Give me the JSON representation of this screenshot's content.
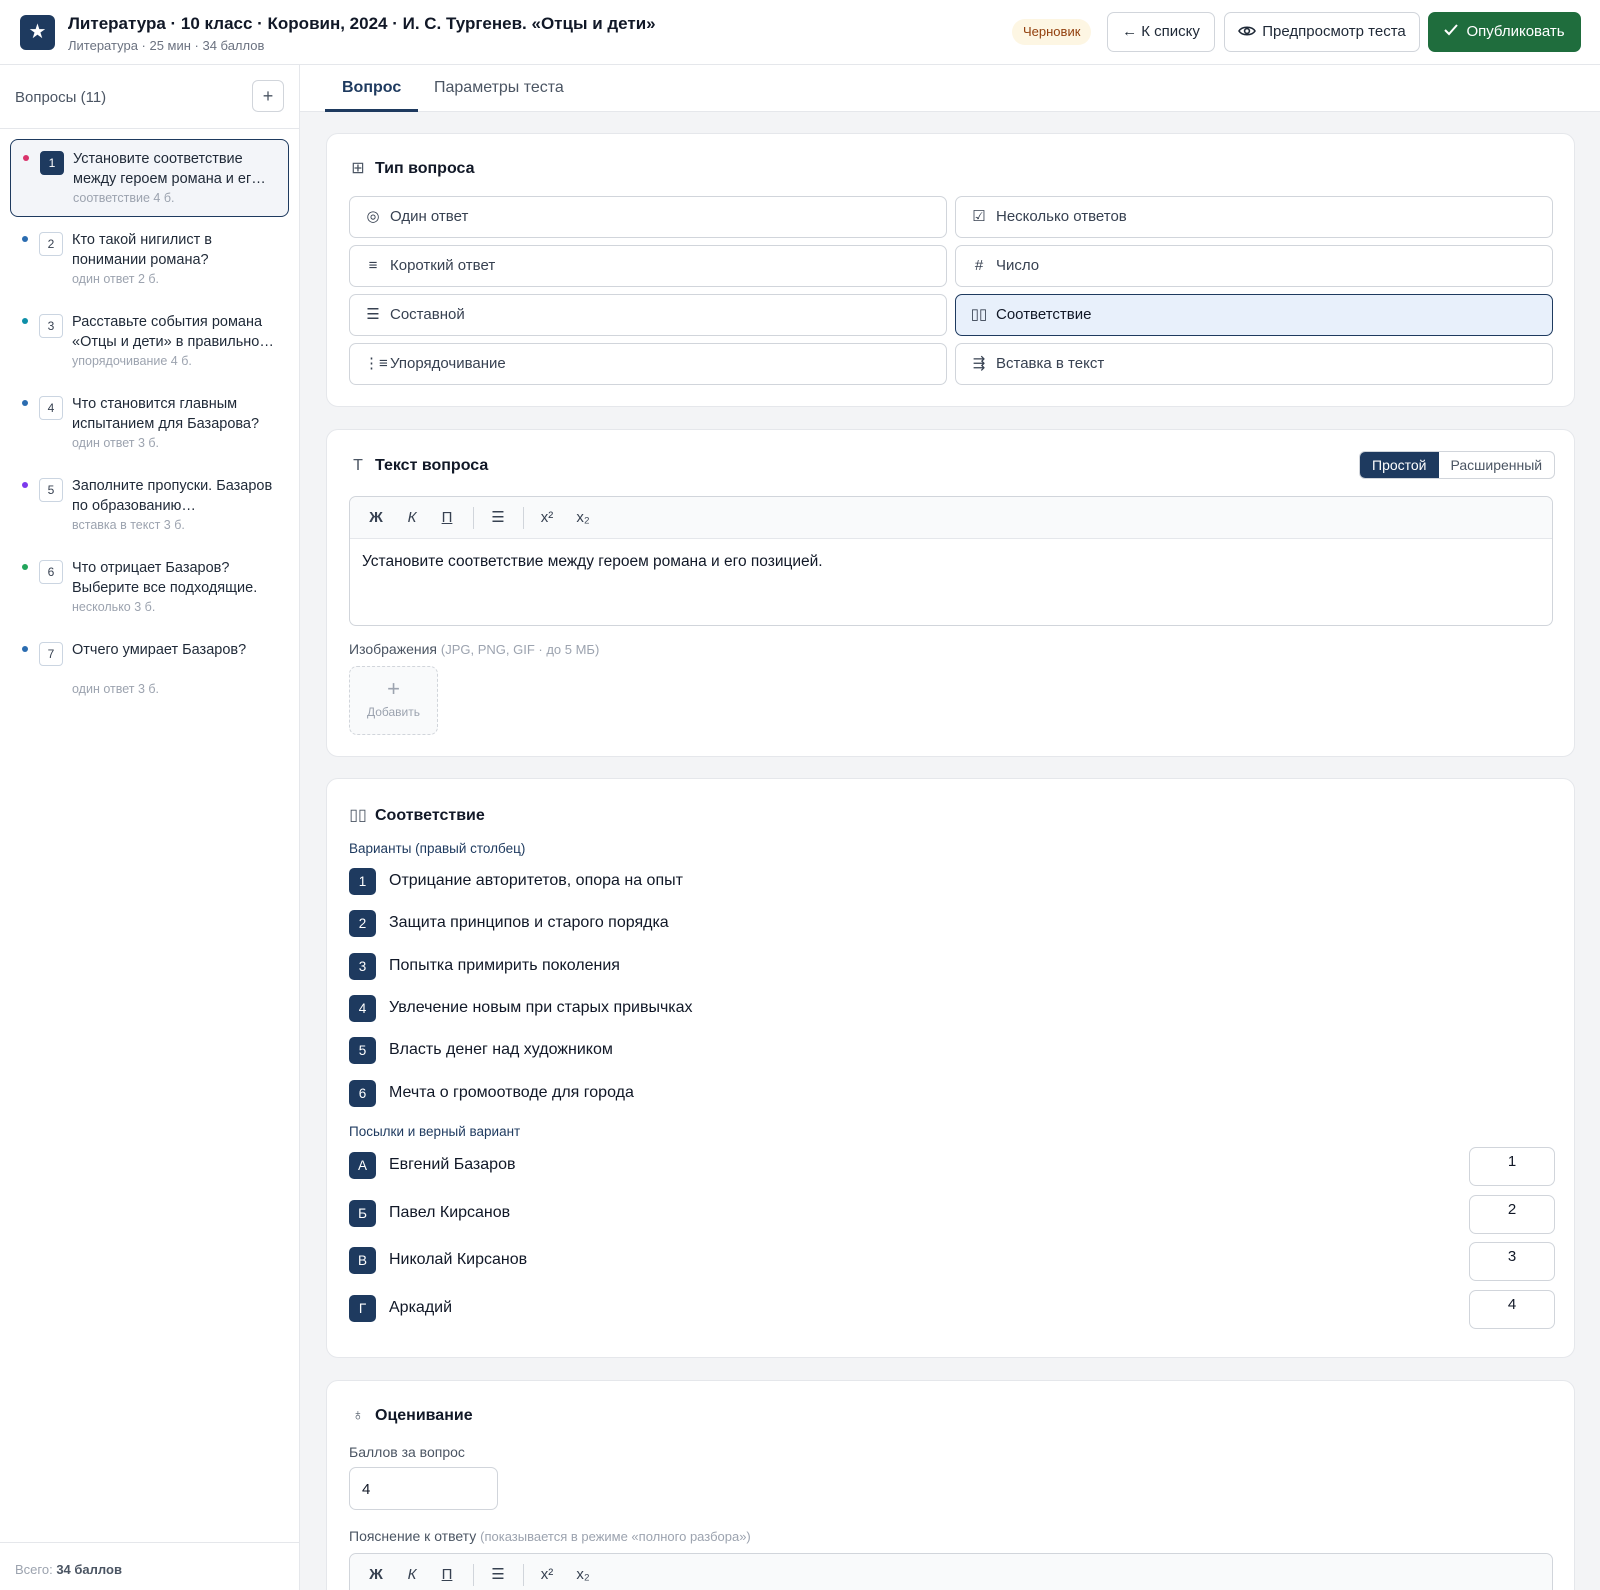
{
  "header": {
    "logo_glyph": "★",
    "title": "Литература · 10 класс · Коровин, 2024 · И. С. Тургенев. «Отцы и дети»",
    "subtitle": "Литература · 25 мин · 34 баллов",
    "status_badge": "Черновик",
    "back_label": "← К списку",
    "preview_label": "Предпросмотр теста",
    "publish_label": "Опубликовать",
    "preview_icon": "eye-icon",
    "publish_icon": "check-icon"
  },
  "sidebar": {
    "heading": "Вопросы (11)",
    "add_glyph": "+",
    "footer_prefix": "Всего:",
    "footer_value": "34 баллов",
    "items": [
      {
        "num": "1",
        "text": "Установите соответствие между героем романа и ег…",
        "meta": "соответствие  4 б.",
        "dot": "#d9336b"
      },
      {
        "num": "2",
        "text": "Кто такой нигилист в понимании романа?",
        "meta": "один ответ  2 б.",
        "dot": "#2b6cb0"
      },
      {
        "num": "3",
        "text": "Расставьте события романа «Отцы и дети» в правильно…",
        "meta": "упорядочивание  4 б.",
        "dot": "#0e8fa8"
      },
      {
        "num": "4",
        "text": "Что становится главным испытанием для Базарова?",
        "meta": "один ответ  3 б.",
        "dot": "#2b6cb0"
      },
      {
        "num": "5",
        "text": "Заполните пропуски. Базаров по образованию…",
        "meta": "вставка в текст  3 б.",
        "dot": "#7c3aed"
      },
      {
        "num": "6",
        "text": "Что отрицает Базаров? Выберите все подходящие.",
        "meta": "несколько  3 б.",
        "dot": "#22a55b"
      },
      {
        "num": "7",
        "text": "Отчего умирает Базаров?",
        "meta": "один ответ  3 б.",
        "dot": "#2b6cb0"
      }
    ]
  },
  "tabs": {
    "question": "Вопрос",
    "settings": "Параметры теста"
  },
  "qtype": {
    "title": "Тип вопроса",
    "options": [
      {
        "label": "Один ответ",
        "icon": "radio-icon",
        "glyph": "◎"
      },
      {
        "label": "Несколько ответов",
        "icon": "checkbox-icon",
        "glyph": "☑"
      },
      {
        "label": "Короткий ответ",
        "icon": "text-lines-icon",
        "glyph": "≡"
      },
      {
        "label": "Число",
        "icon": "hash-icon",
        "glyph": "#"
      },
      {
        "label": "Составной",
        "icon": "list-icon",
        "glyph": "☰"
      },
      {
        "label": "Соответствие",
        "icon": "columns-icon",
        "glyph": "▯▯"
      },
      {
        "label": "Упорядочивание",
        "icon": "ordered-list-icon",
        "glyph": "⋮≡"
      },
      {
        "label": "Вставка в текст",
        "icon": "insert-text-icon",
        "glyph": "⇶"
      }
    ]
  },
  "question_text": {
    "title": "Текст вопроса",
    "mode_simple": "Простой",
    "mode_advanced": "Расширенный",
    "toolbar": {
      "bold": "Ж",
      "italic": "К",
      "underline": "П",
      "list": "☰",
      "sup": "x²",
      "sub": "x₂"
    },
    "value": "Установите соответствие между героем романа и его позицией.",
    "images_label": "Изображения",
    "images_hint": "(JPG, PNG, GIF · до 5 МБ)",
    "add_glyph": "+",
    "add_label": "Добавить"
  },
  "matching": {
    "title": "Соответствие",
    "options_label": "Варианты (правый столбец)",
    "options": [
      {
        "num": "1",
        "text": "Отрицание авторитетов, опора на опыт"
      },
      {
        "num": "2",
        "text": "Защита принципов и старого порядка"
      },
      {
        "num": "3",
        "text": "Попытка примирить поколения"
      },
      {
        "num": "4",
        "text": "Увлечение новым при старых привычках"
      },
      {
        "num": "5",
        "text": "Власть денег над художником"
      },
      {
        "num": "6",
        "text": "Мечта о громоотводе для города"
      }
    ],
    "premises_label": "Посылки и верный вариант",
    "premises": [
      {
        "letter": "А",
        "text": "Евгений Базаров",
        "answer": "1"
      },
      {
        "letter": "Б",
        "text": "Павел Кирсанов",
        "answer": "2"
      },
      {
        "letter": "В",
        "text": "Николай Кирсанов",
        "answer": "3"
      },
      {
        "letter": "Г",
        "text": "Аркадий",
        "answer": "4"
      }
    ]
  },
  "grading": {
    "title": "Оценивание",
    "points_label": "Баллов за вопрос",
    "points_value": "4",
    "explanation_label": "Пояснение к ответу",
    "explanation_hint": "(показывается в режиме «полного разбора»)",
    "toolbar": {
      "bold": "Ж",
      "italic": "К",
      "underline": "П",
      "list": "☰",
      "sup": "x²",
      "sub": "x₂"
    }
  }
}
